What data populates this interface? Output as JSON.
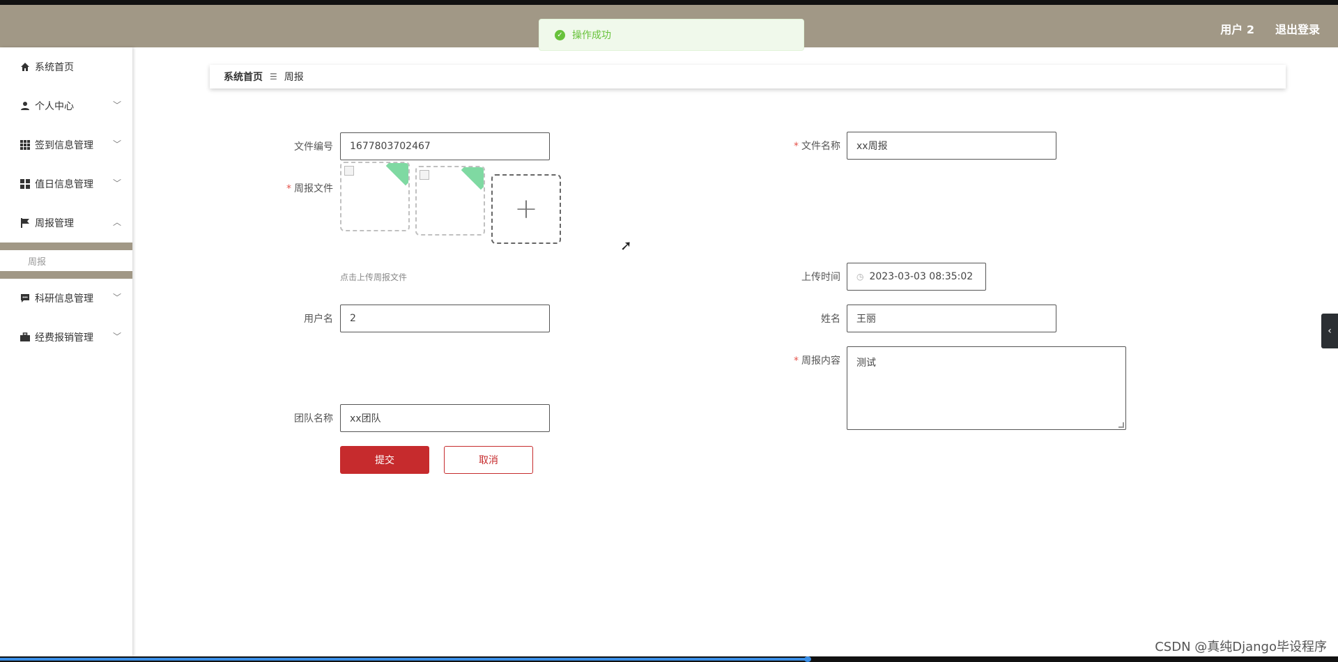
{
  "header": {
    "user": "用户 2",
    "logout": "退出登录"
  },
  "toast": {
    "message": "操作成功"
  },
  "sidebar": {
    "items": [
      {
        "label": "系统首页",
        "icon": "home-icon",
        "expandable": false
      },
      {
        "label": "个人中心",
        "icon": "user-icon",
        "expandable": true
      },
      {
        "label": "签到信息管理",
        "icon": "grid-icon",
        "expandable": true
      },
      {
        "label": "值日信息管理",
        "icon": "apps-icon",
        "expandable": true
      },
      {
        "label": "周报管理",
        "icon": "flag-icon",
        "expandable": true,
        "expanded": true
      },
      {
        "label": "科研信息管理",
        "icon": "chat-icon",
        "expandable": true
      },
      {
        "label": "经费报销管理",
        "icon": "briefcase-icon",
        "expandable": true
      }
    ],
    "sub_item": "周报"
  },
  "breadcrumb": {
    "home": "系统首页",
    "current": "周报"
  },
  "form": {
    "file_no": {
      "label": "文件编号",
      "value": "1677803702467"
    },
    "file_name": {
      "label": "文件名称",
      "value": "xx周报",
      "required": true
    },
    "report_file": {
      "label": "周报文件",
      "required": true,
      "hint": "点击上传周报文件",
      "uploader": "+"
    },
    "upload_time": {
      "label": "上传时间",
      "value": "2023-03-03 08:35:02"
    },
    "username": {
      "label": "用户名",
      "value": "2"
    },
    "name": {
      "label": "姓名",
      "value": "王丽"
    },
    "content": {
      "label": "周报内容",
      "value": "测试",
      "required": true
    },
    "team": {
      "label": "团队名称",
      "value": "xx团队"
    },
    "submit": "提交",
    "cancel": "取消"
  },
  "watermark": "CSDN @真纯Django毕设程序",
  "colors": {
    "header": "#a19886",
    "primary": "#c62b2d",
    "success": "#67c23a"
  }
}
